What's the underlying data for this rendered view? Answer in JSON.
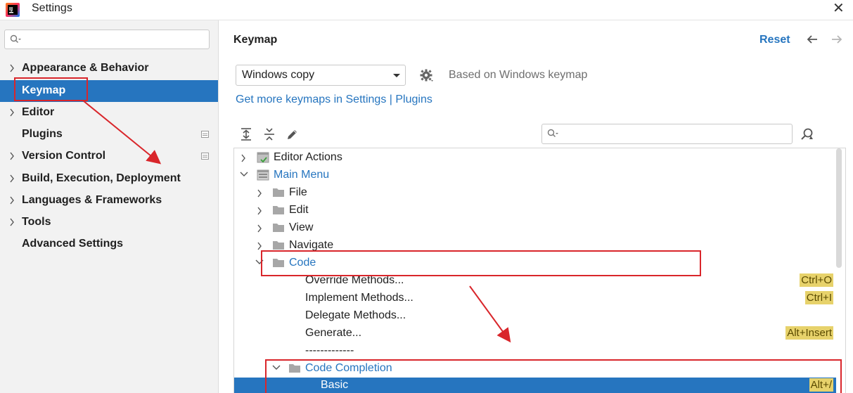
{
  "window": {
    "title": "Settings"
  },
  "sidebar": {
    "search_placeholder": "",
    "items": [
      {
        "label": "Appearance & Behavior",
        "expandable": true
      },
      {
        "label": "Keymap",
        "expandable": false,
        "selected": true
      },
      {
        "label": "Editor",
        "expandable": true
      },
      {
        "label": "Plugins",
        "expandable": false,
        "badge": true
      },
      {
        "label": "Version Control",
        "expandable": true,
        "badge": true
      },
      {
        "label": "Build, Execution, Deployment",
        "expandable": true
      },
      {
        "label": "Languages & Frameworks",
        "expandable": true
      },
      {
        "label": "Tools",
        "expandable": true
      },
      {
        "label": "Advanced Settings",
        "expandable": false
      }
    ]
  },
  "main": {
    "title": "Keymap",
    "reset_label": "Reset",
    "keymap_value": "Windows copy",
    "based_on": "Based on Windows keymap",
    "more_link": "Get more keymaps in Settings | Plugins",
    "filter_placeholder": ""
  },
  "tree": {
    "rows": [
      {
        "label": "Editor Actions",
        "level": 0,
        "chevron": "right",
        "icon": "editor-actions-icon",
        "link": false
      },
      {
        "label": "Main Menu",
        "level": 0,
        "chevron": "down",
        "icon": "main-menu-icon",
        "link": true
      },
      {
        "label": "File",
        "level": 1,
        "chevron": "right",
        "icon": "folder-icon",
        "link": false
      },
      {
        "label": "Edit",
        "level": 1,
        "chevron": "right",
        "icon": "folder-icon",
        "link": false
      },
      {
        "label": "View",
        "level": 1,
        "chevron": "right",
        "icon": "folder-icon",
        "link": false
      },
      {
        "label": "Navigate",
        "level": 1,
        "chevron": "right",
        "icon": "folder-icon",
        "link": false
      },
      {
        "label": "Code",
        "level": 1,
        "chevron": "down",
        "icon": "folder-icon",
        "link": true
      },
      {
        "label": "Override Methods...",
        "level": 2,
        "shortcut": "Ctrl+O"
      },
      {
        "label": "Implement Methods...",
        "level": 2,
        "shortcut": "Ctrl+I"
      },
      {
        "label": "Delegate Methods...",
        "level": 2
      },
      {
        "label": "Generate...",
        "level": 2,
        "shortcut": "Alt+Insert"
      },
      {
        "label": "-------------",
        "level": 2
      },
      {
        "label": "Code Completion",
        "level": 2,
        "chevron": "down",
        "icon": "folder-icon",
        "link": true
      },
      {
        "label": "Basic",
        "level": 3,
        "shortcut": "Alt+/",
        "selected": true
      }
    ]
  },
  "colors": {
    "accent": "#2675bf",
    "shortcut_bg": "#e7d26b",
    "annotation": "#d9262b"
  }
}
